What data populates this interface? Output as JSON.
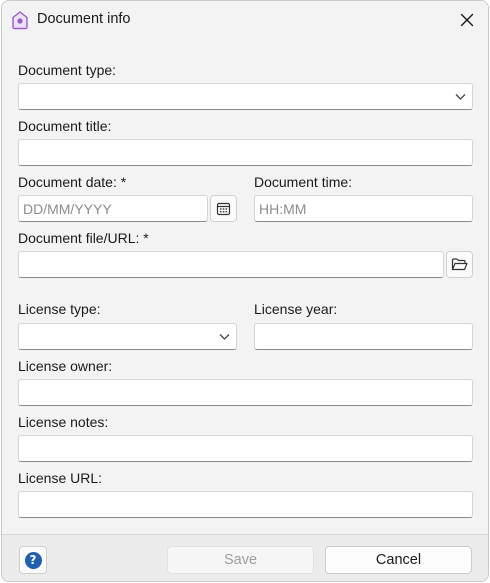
{
  "dialog": {
    "title": "Document info",
    "icon": "home-app-icon"
  },
  "fields": {
    "document_type": {
      "label": "Document type:",
      "value": ""
    },
    "document_title": {
      "label": "Document title:",
      "value": ""
    },
    "document_date": {
      "label": "Document date: *",
      "placeholder": "DD/MM/YYYY",
      "value": ""
    },
    "document_time": {
      "label": "Document time:",
      "placeholder": "HH:MM",
      "value": ""
    },
    "document_file": {
      "label": "Document file/URL: *",
      "value": ""
    },
    "license_type": {
      "label": "License type:",
      "value": ""
    },
    "license_year": {
      "label": "License year:",
      "value": ""
    },
    "license_owner": {
      "label": "License owner:",
      "value": ""
    },
    "license_notes": {
      "label": "License notes:",
      "value": ""
    },
    "license_url": {
      "label": "License URL:",
      "value": ""
    }
  },
  "footer": {
    "help": "?",
    "save": "Save",
    "cancel": "Cancel"
  },
  "colors": {
    "accent": "#1f5fb0",
    "icon_purple": "#9b59d0"
  }
}
